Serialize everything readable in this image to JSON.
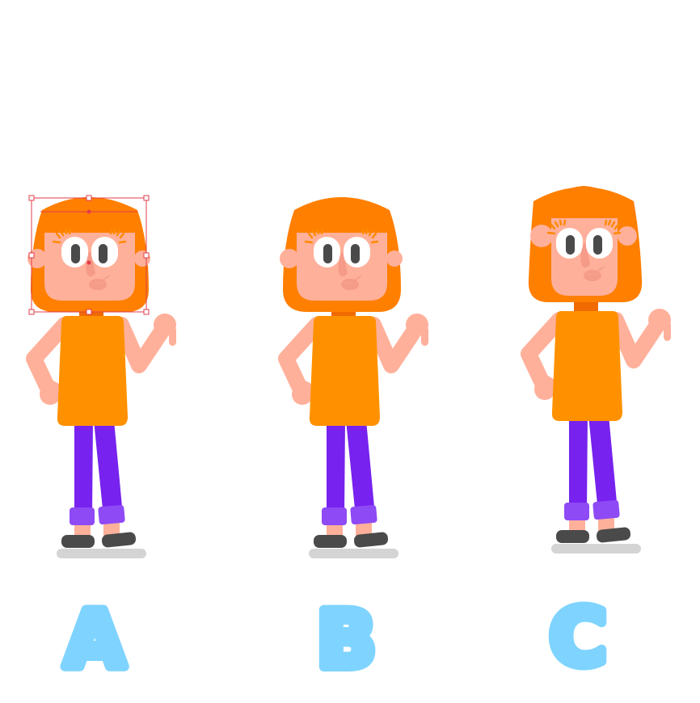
{
  "colors": {
    "hair": "#FF7F00",
    "hair_dark": "#F06A00",
    "skin": "#FFB09A",
    "skin_dark": "#F4A08A",
    "shirt": "#FF9100",
    "pants": "#7722EE",
    "pants_cuff": "#8E4AF5",
    "shoes": "#4A4A4A",
    "shadow": "#D4D4D4",
    "eye_white": "#FFFFFF",
    "pupil": "#4A4A4A",
    "lashes": "#FF8A00",
    "cheek": "#F59B88",
    "label": "#7FD4FF",
    "selection": "#E23C4A"
  },
  "figures": [
    {
      "id": "A",
      "label": "A",
      "selected": true
    },
    {
      "id": "B",
      "label": "B",
      "selected": false
    },
    {
      "id": "C",
      "label": "C",
      "selected": false
    }
  ]
}
